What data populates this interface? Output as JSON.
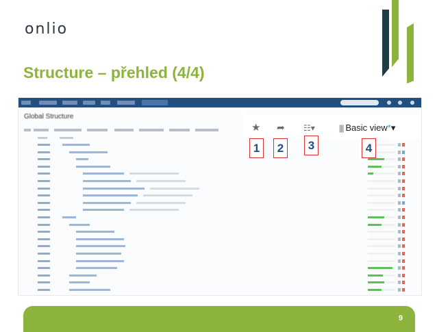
{
  "brand": {
    "logo_text": "onlio"
  },
  "slide": {
    "title": "Structure – přehled (4/4)",
    "page_number": "9"
  },
  "screenshot": {
    "page_title": "Global Structure",
    "toolbar": {
      "star_icon": "★",
      "share_icon": "➦",
      "view_icon": "☷▾",
      "view_bars": "|||",
      "view_label": "Basic view",
      "view_modified_mark": "*",
      "view_caret": "▾"
    },
    "callouts": [
      "1",
      "2",
      "3",
      "4"
    ]
  },
  "colors": {
    "accent_green": "#8cb43c",
    "header_blue": "#214f7e",
    "callout_red": "#d9302f",
    "callout_text": "#1d4d85"
  }
}
